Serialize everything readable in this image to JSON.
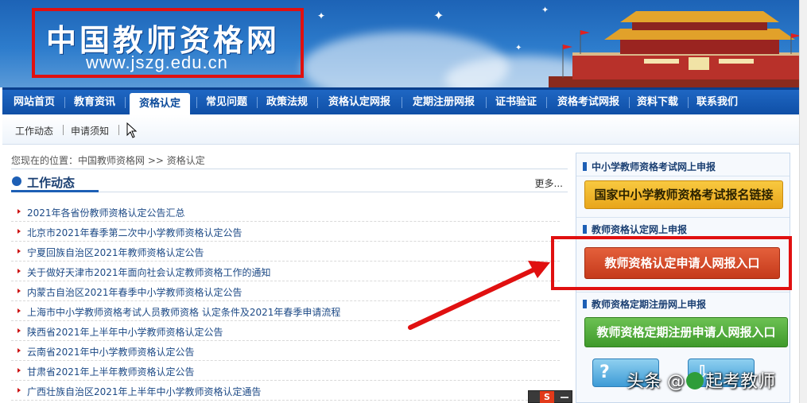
{
  "site": {
    "logo_title": "中国教师资格网",
    "logo_url": "www.jszg.edu.cn"
  },
  "nav": {
    "items": [
      {
        "label": "网站首页"
      },
      {
        "label": "教育资讯"
      },
      {
        "label": "资格认定",
        "active": true
      },
      {
        "label": "常见问题"
      },
      {
        "label": "政策法规"
      },
      {
        "label": "资格认定网报"
      },
      {
        "label": "定期注册网报"
      },
      {
        "label": "证书验证"
      },
      {
        "label": "资格考试网报"
      },
      {
        "label": "资料下载"
      },
      {
        "label": "联系我们"
      }
    ]
  },
  "subnav": {
    "items": [
      {
        "label": "工作动态"
      },
      {
        "label": "申请须知"
      }
    ]
  },
  "breadcrumb": {
    "prefix": "您现在的位置：",
    "home": "中国教师资格网",
    "sep": " >> ",
    "current": "资格认定"
  },
  "section": {
    "title": "工作动态",
    "more": "更多..."
  },
  "news": [
    "2021年各省份教师资格认定公告汇总",
    "北京市2021年春季第二次中小学教师资格认定公告",
    "宁夏回族自治区2021年教师资格认定公告",
    "关于做好天津市2021年面向社会认定教师资格工作的通知",
    "内蒙古自治区2021年春季中小学教师资格认定公告",
    "上海市中小学教师资格考试人员教师资格 认定条件及2021年春季申请流程",
    "陕西省2021年上半年中小学教师资格认定公告",
    "云南省2021年中小学教师资格认定公告",
    "甘肃省2021年上半年教师资格认定公告",
    "广西壮族自治区2021年上半年中小学教师资格认定通告"
  ],
  "sidebar": {
    "exam_head": "中小学教师资格考试网上申报",
    "exam_button": "国家中小学教师资格考试报名链接",
    "cert_head": "教师资格认定网上申报",
    "cert_button": "教师资格认定申请人网报入口",
    "reg_head": "教师资格定期注册网上申报",
    "reg_button": "教师资格定期注册申请人网报入口"
  },
  "watermark": {
    "prefix": "头条 @",
    "suffix": "起考教师"
  },
  "widget": {
    "letter": "S"
  },
  "colors": {
    "nav_blue": "#0f4fa6",
    "highlight_red": "#e01010",
    "link_blue": "#1d4a86"
  }
}
